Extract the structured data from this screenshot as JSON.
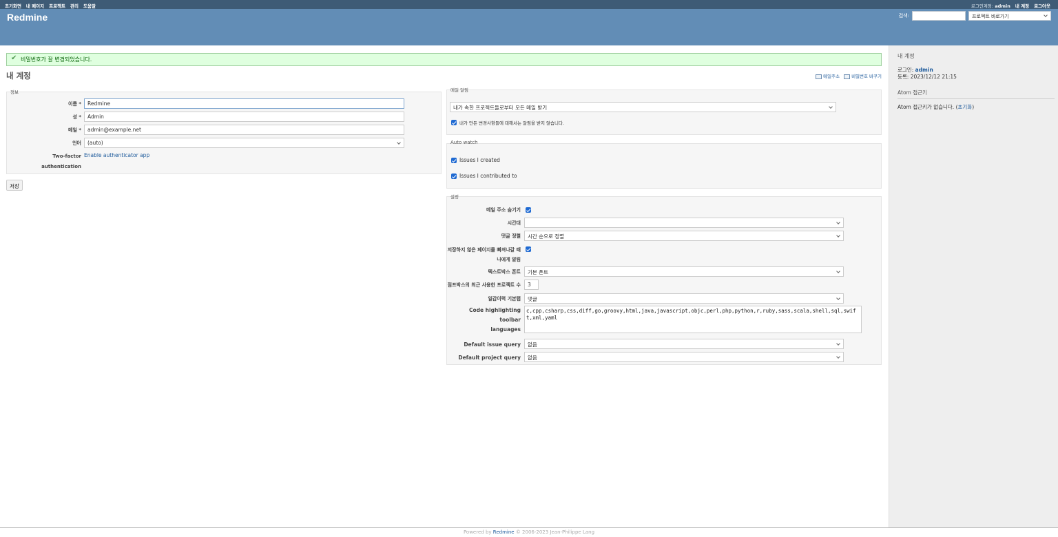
{
  "top_menu": {
    "left": [
      "초기화면",
      "내 페이지",
      "프로젝트",
      "관리",
      "도움말"
    ],
    "logged_as_label": "로그인계정:",
    "logged_user": "admin",
    "right": [
      "내 계정",
      "로그아웃"
    ]
  },
  "header": {
    "title": "Redmine",
    "search_label": "검색:",
    "search_value": "",
    "jump_label": "프로젝트 바로가기"
  },
  "flash": "비밀번호가 잘 변경되었습니다.",
  "page_title": "내 계정",
  "contextual": {
    "email_link": "메일주소",
    "password_link": "비밀번호 바꾸기"
  },
  "info": {
    "legend": "정보",
    "firstname_label": "이름 *",
    "firstname_value": "Redmine",
    "lastname_label": "성 *",
    "lastname_value": "Admin",
    "mail_label": "메일 *",
    "mail_value": "admin@example.net",
    "language_label": "언어",
    "language_value": "(auto)",
    "twofa_label_1": "Two-factor",
    "twofa_label_2": "authentication",
    "twofa_link": "Enable authenticator app"
  },
  "save_button": "저장",
  "mail_notification": {
    "legend": "메일 알림",
    "select_value": "내가 속한 프로젝트들로부터 모든 메일 받기",
    "no_self_notified": "내가 만든 변경사항들에 대해서는 알림을 받지 않습니다.",
    "no_self_checked": true
  },
  "auto_watch": {
    "legend": "Auto watch",
    "items": [
      {
        "label": "Issues I created",
        "checked": true
      },
      {
        "label": "Issues I contributed to",
        "checked": true
      }
    ]
  },
  "preferences": {
    "legend": "설정",
    "hide_mail_label": "메일 주소 숨기기",
    "hide_mail_checked": true,
    "timezone_label": "시간대",
    "timezone_value": "",
    "comments_order_label": "댓글 정렬",
    "comments_order_value": "시간 순으로 정렬",
    "warn_unsaved_label_1": "저장하지 않은 페이지를 빠져나갈 때",
    "warn_unsaved_label_2": "나에게 알림",
    "warn_unsaved_checked": true,
    "textarea_font_label": "텍스트박스 폰트",
    "textarea_font_value": "기본 폰트",
    "recently_used_label": "점프박스의 최근 사용한 프로젝트 수",
    "recently_used_value": "3",
    "history_tab_label": "일감이력 기본탭",
    "history_tab_value": "댓글",
    "toolbar_lang_label_1": "Code highlighting toolbar",
    "toolbar_lang_label_2": "languages",
    "toolbar_lang_value": "c,cpp,csharp,css,diff,go,groovy,html,java,javascript,objc,perl,php,python,r,ruby,sass,scala,shell,sql,swift,xml,yaml",
    "default_issue_query_label": "Default issue query",
    "default_issue_query_value": "없음",
    "default_project_query_label": "Default project query",
    "default_project_query_value": "없음"
  },
  "sidebar": {
    "title": "내 계정",
    "login_label": "로그인:",
    "login_value": "admin",
    "registered_label": "등록:",
    "registered_value": "2023/12/12 21:15",
    "atom_title": "Atom 접근키",
    "atom_text": "Atom 접근키가 없습니다.",
    "atom_reset_open": "(",
    "atom_reset": "초기화",
    "atom_reset_close": ")"
  },
  "footer": {
    "powered_by": "Powered by",
    "redmine": "Redmine",
    "copyright": "© 2006-2023 Jean-Philippe Lang"
  }
}
